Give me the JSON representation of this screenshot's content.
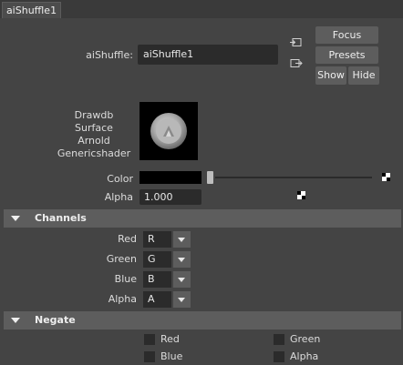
{
  "tab": {
    "label": "aiShuffle1"
  },
  "header": {
    "node_label": "aiShuffle:",
    "node_value": "aiShuffle1",
    "focus_label": "Focus",
    "presets_label": "Presets",
    "show_label": "Show",
    "hide_label": "Hide"
  },
  "swatch": {
    "lines": [
      "Drawdb",
      "Surface",
      "Arnold",
      "Genericshader"
    ]
  },
  "attributes": {
    "color_label": "Color",
    "color_value": "#000000",
    "alpha_label": "Alpha",
    "alpha_value": "1.000"
  },
  "channels": {
    "title": "Channels",
    "rows": [
      {
        "label": "Red",
        "value": "R"
      },
      {
        "label": "Green",
        "value": "G"
      },
      {
        "label": "Blue",
        "value": "B"
      },
      {
        "label": "Alpha",
        "value": "A"
      }
    ]
  },
  "negate": {
    "title": "Negate",
    "items": [
      {
        "label": "Red",
        "checked": false
      },
      {
        "label": "Green",
        "checked": false
      },
      {
        "label": "Blue",
        "checked": false
      },
      {
        "label": "Alpha",
        "checked": false
      }
    ]
  },
  "icons": {
    "input_connection": "input-connection-icon",
    "output_connection": "output-connection-icon",
    "map_texture": "checker-map-icon",
    "section_toggle": "triangle-down-icon",
    "shader_ball": "shader-ball-icon"
  },
  "colors": {
    "background": "#444444",
    "field": "#2b2b2b",
    "button": "#5d5d5d",
    "text": "#dddddd"
  }
}
